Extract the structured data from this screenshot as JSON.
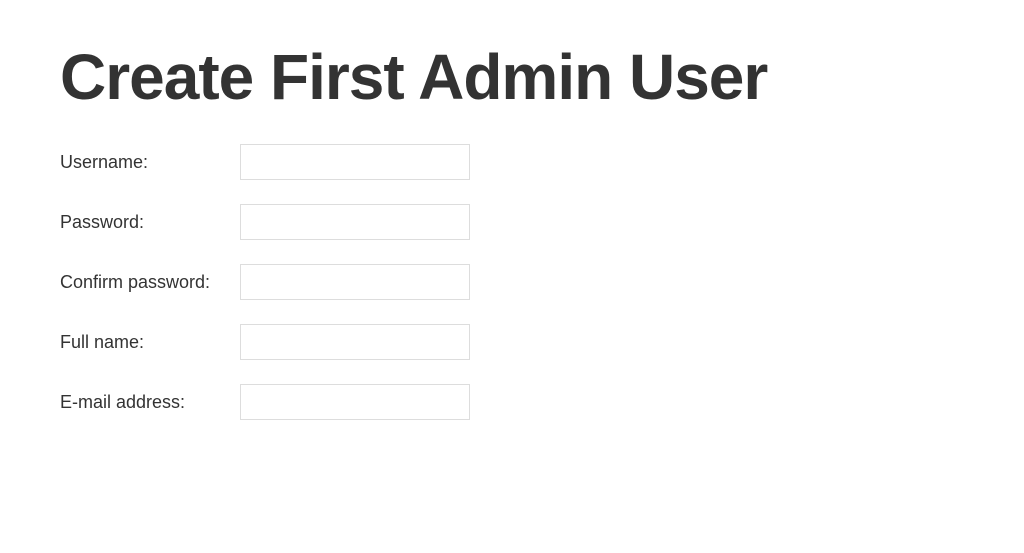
{
  "title": "Create First Admin User",
  "form": {
    "fields": [
      {
        "label": "Username:",
        "value": "",
        "type": "text"
      },
      {
        "label": "Password:",
        "value": "",
        "type": "password"
      },
      {
        "label": "Confirm password:",
        "value": "",
        "type": "password"
      },
      {
        "label": "Full name:",
        "value": "",
        "type": "text"
      },
      {
        "label": "E-mail address:",
        "value": "",
        "type": "text"
      }
    ]
  }
}
